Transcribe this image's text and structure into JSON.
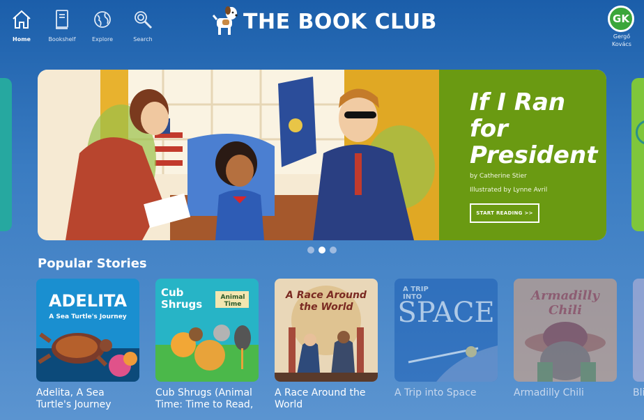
{
  "nav": {
    "items": [
      {
        "label": "Home",
        "icon": "home-icon"
      },
      {
        "label": "Bookshelf",
        "icon": "book-icon"
      },
      {
        "label": "Explore",
        "icon": "globe-icon"
      },
      {
        "label": "Search",
        "icon": "search-icon"
      }
    ]
  },
  "brand": {
    "title": "THE BOOK CLUB"
  },
  "profile": {
    "initials": "GK",
    "name_line1": "Gergő",
    "name_line2": "Kovács",
    "avatar_color": "#3aa63a"
  },
  "hero": {
    "title": "If I Ran for President",
    "author": "by Catherine Stier",
    "illustrator": "Illustrated by Lynne Avril",
    "cta": "START READING >>",
    "panel_color": "#6a9a12"
  },
  "carousel": {
    "active_dot": 2,
    "dot_count": 3
  },
  "popular": {
    "title": "Popular Stories",
    "books": [
      {
        "title_line1": "Adelita, A Sea",
        "title_line2": "Turtle's Journey",
        "cover_title": "ADELITA",
        "cover_subtitle": "A Sea Turtle's Journey"
      },
      {
        "title_line1": "Cub Shrugs (Animal",
        "title_line2": "Time: Time to Read,",
        "cover_title": "Cub Shrugs",
        "cover_subtitle": "Animal Time"
      },
      {
        "title_line1": "A Race Around the",
        "title_line2": "World",
        "cover_title": "A Race Around the World",
        "cover_subtitle": ""
      },
      {
        "title_line1": "A Trip into Space",
        "title_line2": "",
        "cover_title": "SPACE",
        "cover_subtitle": "A TRIP INTO"
      },
      {
        "title_line1": "Armadilly Chili",
        "title_line2": "",
        "cover_title": "Armadilly Chili",
        "cover_subtitle": ""
      },
      {
        "title_line1": "Bli",
        "title_line2": "",
        "cover_title": "",
        "cover_subtitle": ""
      }
    ]
  }
}
